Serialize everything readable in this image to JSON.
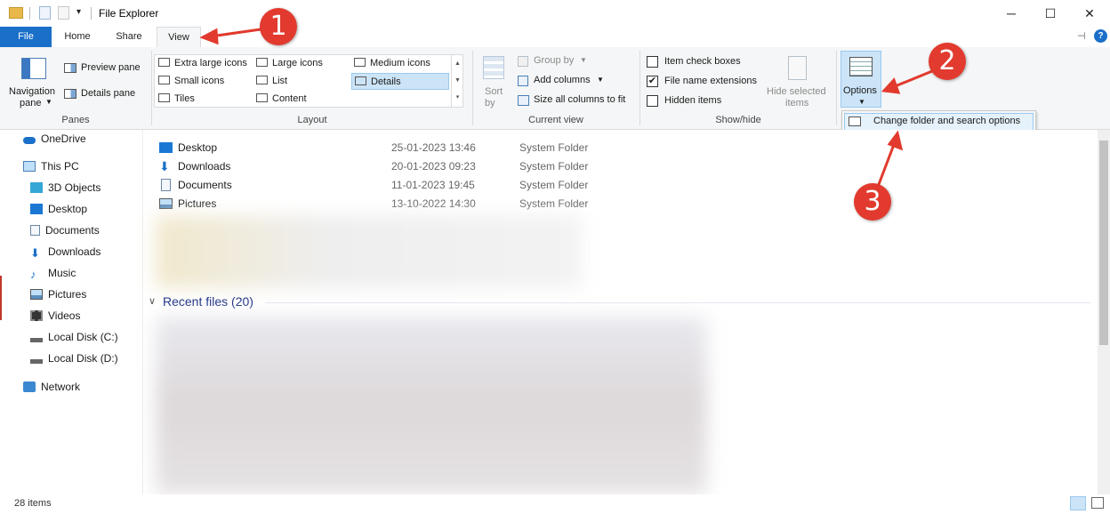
{
  "window": {
    "title": "File Explorer",
    "controls": {
      "minimize": "─",
      "maximize": "☐",
      "close": "✕"
    }
  },
  "tabs": [
    {
      "label": "File"
    },
    {
      "label": "Home"
    },
    {
      "label": "Share"
    },
    {
      "label": "View"
    }
  ],
  "ribbon": {
    "panes": {
      "navigation_pane_line1": "Navigation",
      "navigation_pane_line2": "pane",
      "preview_pane": "Preview pane",
      "details_pane": "Details pane",
      "label": "Panes"
    },
    "layout": {
      "items": [
        {
          "label": "Extra large icons"
        },
        {
          "label": "Large icons"
        },
        {
          "label": "Medium icons"
        },
        {
          "label": "Small icons"
        },
        {
          "label": "List"
        },
        {
          "label": "Details"
        },
        {
          "label": "Tiles"
        },
        {
          "label": "Content"
        }
      ],
      "selected": "Details",
      "label": "Layout"
    },
    "current_view": {
      "sort_line1": "Sort",
      "sort_line2": "by",
      "group_by": "Group by",
      "add_columns": "Add columns",
      "size_all_columns": "Size all columns to fit",
      "label": "Current view"
    },
    "show_hide": {
      "item_check_boxes": {
        "label": "Item check boxes",
        "checked": false
      },
      "file_name_extensions": {
        "label": "File name extensions",
        "checked": true
      },
      "hidden_items": {
        "label": "Hidden items",
        "checked": false
      },
      "hide_selected_line1": "Hide selected",
      "hide_selected_line2": "items",
      "label": "Show/hide"
    },
    "options": {
      "label": "Options",
      "dropdown_item": "Change folder and search options"
    }
  },
  "nav": {
    "items": [
      {
        "label": "OneDrive"
      },
      {
        "label": "This PC"
      },
      {
        "label": "3D Objects"
      },
      {
        "label": "Desktop"
      },
      {
        "label": "Documents"
      },
      {
        "label": "Downloads"
      },
      {
        "label": "Music"
      },
      {
        "label": "Pictures"
      },
      {
        "label": "Videos"
      },
      {
        "label": "Local Disk (C:)"
      },
      {
        "label": "Local Disk (D:)"
      },
      {
        "label": "Network"
      }
    ]
  },
  "folders": [
    {
      "name": "Desktop",
      "date": "25-01-2023 13:46",
      "type": "System Folder"
    },
    {
      "name": "Downloads",
      "date": "20-01-2023 09:23",
      "type": "System Folder"
    },
    {
      "name": "Documents",
      "date": "11-01-2023 19:45",
      "type": "System Folder"
    },
    {
      "name": "Pictures",
      "date": "13-10-2022 14:30",
      "type": "System Folder"
    }
  ],
  "recent_files": {
    "header": "Recent files (20)"
  },
  "status": {
    "item_count": "28 items"
  },
  "annotations": [
    {
      "number": "1"
    },
    {
      "number": "2"
    },
    {
      "number": "3"
    }
  ],
  "colors": {
    "accent": "#1a6fc9",
    "annotation": "#e23a2e"
  }
}
